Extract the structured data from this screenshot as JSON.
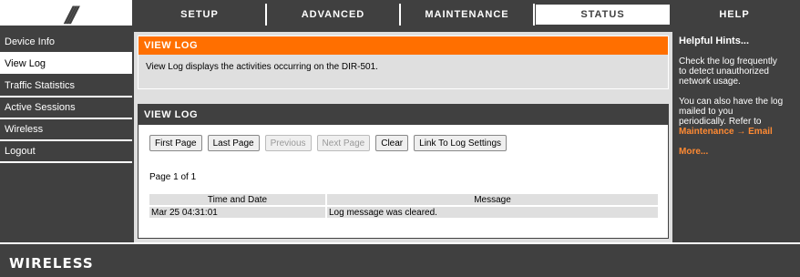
{
  "nav": {
    "tabs": [
      {
        "label": "SETUP"
      },
      {
        "label": "ADVANCED"
      },
      {
        "label": "MAINTENANCE"
      },
      {
        "label": "STATUS"
      },
      {
        "label": "HELP"
      }
    ],
    "active": "STATUS"
  },
  "menu": {
    "items": [
      {
        "label": "Device Info"
      },
      {
        "label": "View Log"
      },
      {
        "label": "Traffic Statistics"
      },
      {
        "label": "Active Sessions"
      },
      {
        "label": "Wireless"
      },
      {
        "label": "Logout"
      }
    ],
    "active": "View Log"
  },
  "intro": {
    "title": "VIEW LOG",
    "description": "View Log displays the activities occurring on the DIR-501."
  },
  "log": {
    "title": "VIEW LOG",
    "buttons": {
      "first": "First Page",
      "last": "Last Page",
      "previous": "Previous",
      "next": "Next Page",
      "clear": "Clear",
      "settings": "Link To Log Settings"
    },
    "page_info": "Page 1 of 1",
    "columns": [
      "Time and Date",
      "Message"
    ],
    "rows": [
      {
        "time": "Mar 25 04:31:01",
        "message": "Log message was cleared."
      }
    ]
  },
  "hints": {
    "title": "Helpful Hints...",
    "p1": "Check the log frequently\nto detect unauthorized\nnetwork usage.",
    "p2": "You can also have the log\nmailed to you\nperiodically. Refer to",
    "link": "Maintenance → Email",
    "more": "More..."
  },
  "footer": {
    "brand": "WIRELESS"
  },
  "colors": {
    "accent": "#ff6f00",
    "dark": "#404040",
    "panel": "#dfdfdf"
  }
}
